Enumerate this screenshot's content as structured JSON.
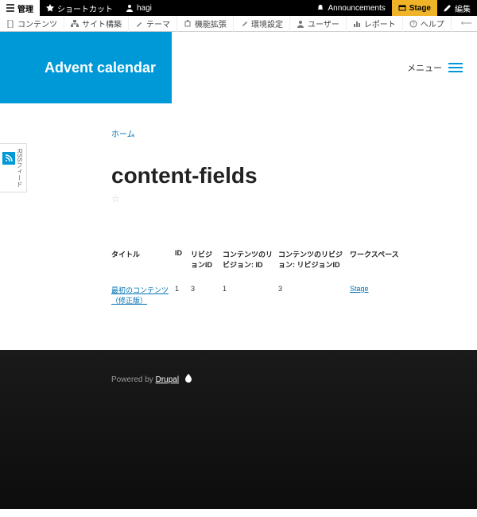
{
  "toolbar": {
    "manage": "管理",
    "shortcuts": "ショートカット",
    "user": "hagi",
    "announcements": "Announcements",
    "stage": "Stage",
    "edit": "編集"
  },
  "subtoolbar": {
    "content": "コンテンツ",
    "structure": "サイト構築",
    "appearance": "テーマ",
    "extend": "機能拡張",
    "config": "環境設定",
    "people": "ユーザー",
    "reports": "レポート",
    "help": "ヘルプ"
  },
  "header": {
    "title": "Advent calendar",
    "menu_label": "メニュー"
  },
  "sidebar": {
    "rss_label": "RSSフィード"
  },
  "breadcrumb": {
    "home": "ホーム"
  },
  "page": {
    "title": "content-fields"
  },
  "table": {
    "headers": {
      "title": "タイトル",
      "id": "ID",
      "revision_id": "リビジョンID",
      "content_revision_id": "コンテンツのリビジョン: ID",
      "content_revision_revid": "コンテンツのリビジョン: リビジョンID",
      "workspace": "ワークスペース"
    },
    "row": {
      "title": "最初のコンテンツ（修正版）",
      "id": "1",
      "revision_id": "3",
      "content_revision_id": "1",
      "content_revision_revid": "3",
      "workspace": "Stage"
    }
  },
  "footer": {
    "powered_by": "Powered by",
    "drupal": "Drupal"
  }
}
